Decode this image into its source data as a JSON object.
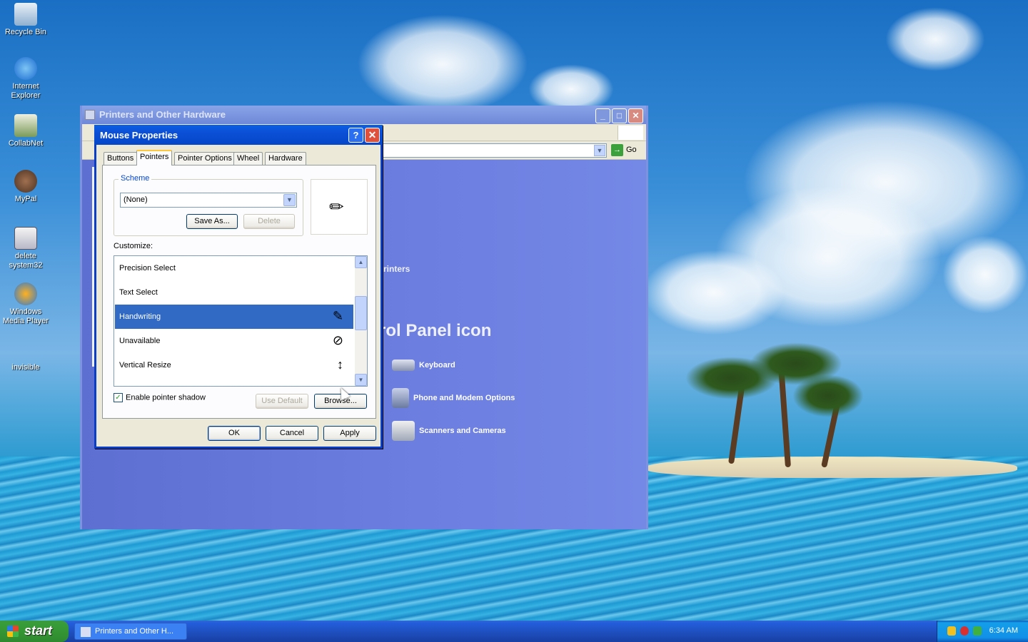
{
  "desktop": {
    "icons": [
      {
        "label": "Recycle Bin"
      },
      {
        "label": "Internet Explorer"
      },
      {
        "label": "CollabNet"
      },
      {
        "label": "MyPal"
      },
      {
        "label": "delete system32"
      },
      {
        "label": "Windows Media Player"
      },
      {
        "label": "invisible"
      }
    ]
  },
  "back_window": {
    "title": "Printers and Other Hardware",
    "go_label": "Go",
    "partial_text_printers": "rinters",
    "partial_heading": "rol Panel icon",
    "items": [
      {
        "label": "Keyboard",
        "icon": "keyboard-icon"
      },
      {
        "label": "Phone and Modem Options",
        "icon": "phone-icon"
      },
      {
        "label": "Scanners and Cameras",
        "icon": "scanner-icon"
      }
    ]
  },
  "dialog": {
    "title": "Mouse Properties",
    "tabs": [
      {
        "label": "Buttons"
      },
      {
        "label": "Pointers",
        "active": true
      },
      {
        "label": "Pointer Options"
      },
      {
        "label": "Wheel"
      },
      {
        "label": "Hardware"
      }
    ],
    "scheme_label": "Scheme",
    "scheme_value": "(None)",
    "save_as_label": "Save As...",
    "delete_label": "Delete",
    "customize_label": "Customize:",
    "pointers": [
      {
        "label": "Precision Select",
        "cursor": ""
      },
      {
        "label": "Text Select",
        "cursor": ""
      },
      {
        "label": "Handwriting",
        "cursor": "✎",
        "selected": true
      },
      {
        "label": "Unavailable",
        "cursor": "⊘"
      },
      {
        "label": "Vertical Resize",
        "cursor": "↕"
      }
    ],
    "shadow_label": "Enable pointer shadow",
    "shadow_checked": true,
    "use_default_label": "Use Default",
    "browse_label": "Browse...",
    "ok_label": "OK",
    "cancel_label": "Cancel",
    "apply_label": "Apply"
  },
  "taskbar": {
    "start_label": "start",
    "task_label": "Printers and Other H...",
    "clock": "6:34 AM"
  },
  "colors": {
    "selection": "#316ac5",
    "title_active": "#0b4fd6",
    "title_inactive": "#7d93e0"
  }
}
